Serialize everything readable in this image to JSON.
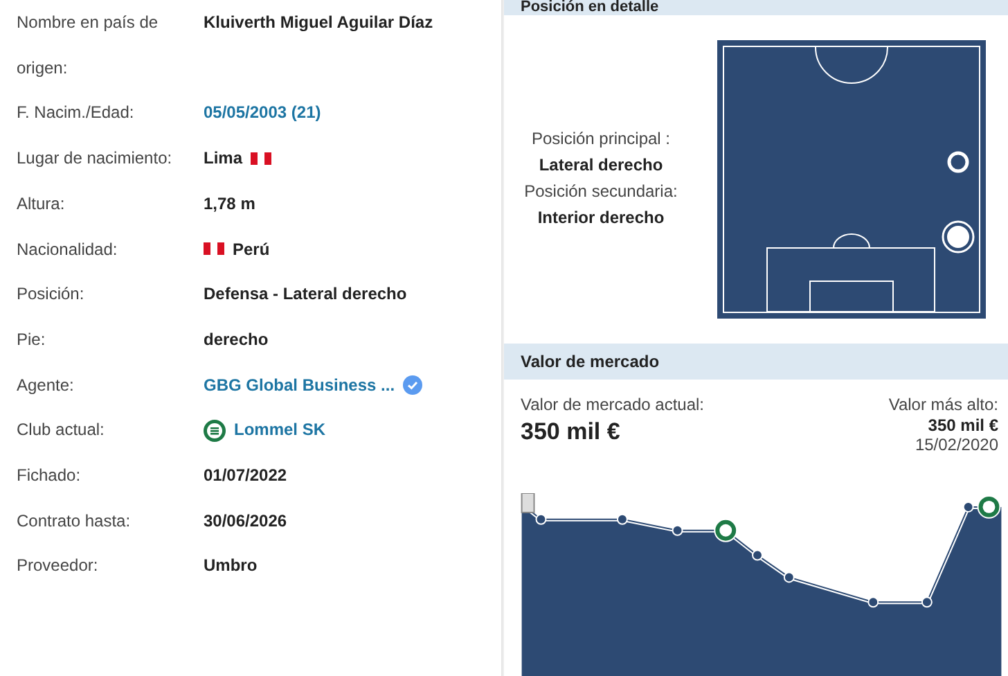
{
  "profile": [
    {
      "label": "Nombre en país de origen:",
      "value": "Kluiverth Miguel Aguilar Díaz",
      "kind": "plain"
    },
    {
      "label": "F. Nacim./Edad:",
      "value": "05/05/2003 (21)",
      "kind": "link"
    },
    {
      "label": "Lugar de nacimiento:",
      "value": "Lima",
      "kind": "flagafter"
    },
    {
      "label": "Altura:",
      "value": "1,78 m",
      "kind": "plain"
    },
    {
      "label": "Nacionalidad:",
      "value": "Perú",
      "kind": "flagbefore"
    },
    {
      "label": "Posición:",
      "value": "Defensa - Lateral derecho",
      "kind": "plain"
    },
    {
      "label": "Pie:",
      "value": "derecho",
      "kind": "plain"
    },
    {
      "label": "Agente:",
      "value": "GBG Global Business ...",
      "kind": "agent"
    },
    {
      "label": "Club actual:",
      "value": "Lommel SK",
      "kind": "club"
    },
    {
      "label": "Fichado:",
      "value": "01/07/2022",
      "kind": "plain"
    },
    {
      "label": "Contrato hasta:",
      "value": "30/06/2026",
      "kind": "plain"
    },
    {
      "label": "Proveedor:",
      "value": "Umbro",
      "kind": "plain"
    }
  ],
  "position_detail": {
    "title": "Posición en detalle",
    "main_label": "Posición principal :",
    "main_value": "Lateral derecho",
    "secondary_label": "Posición secundaria:",
    "secondary_value": "Interior derecho"
  },
  "market_value": {
    "title": "Valor de mercado",
    "current_label": "Valor de mercado actual:",
    "current_value": "350 mil €",
    "highest_label": "Valor más alto:",
    "highest_value": "350 mil €",
    "highest_date": "15/02/2020"
  }
}
